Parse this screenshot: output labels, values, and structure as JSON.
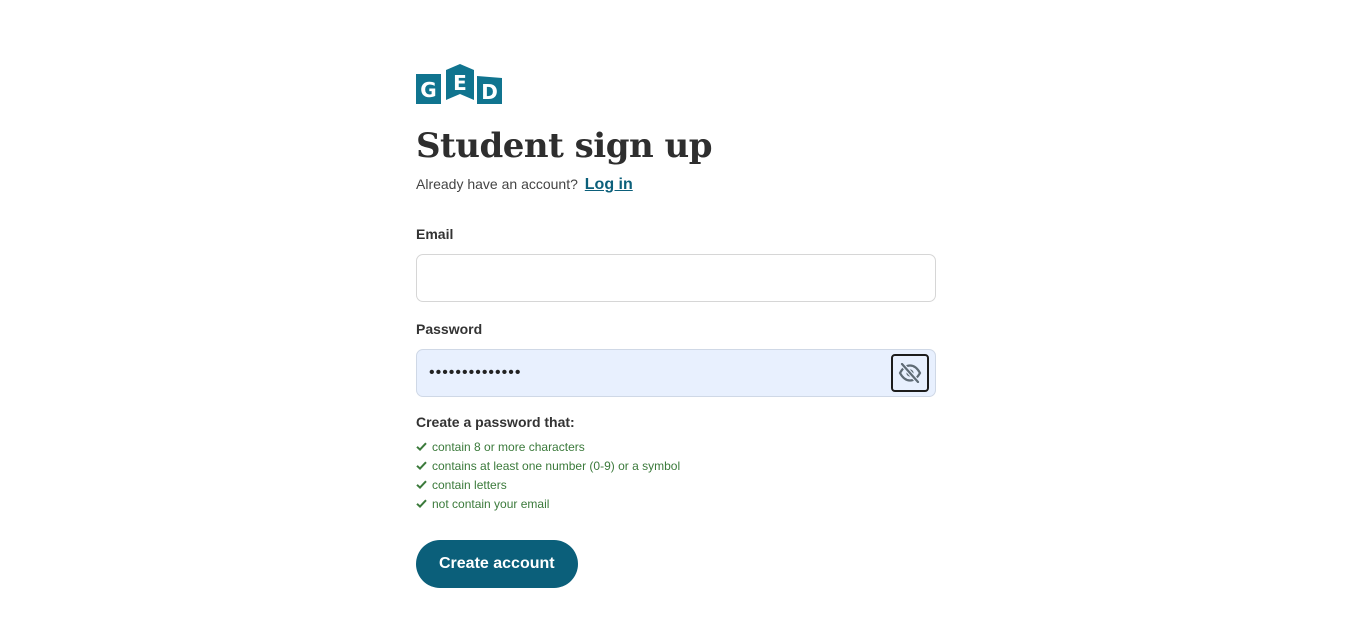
{
  "logo": {
    "letters": [
      "G",
      "E",
      "D"
    ],
    "color": "#10748f"
  },
  "header": {
    "title": "Student sign up",
    "subtitle": "Already have an account?",
    "login_link": "Log in"
  },
  "form": {
    "email": {
      "label": "Email",
      "value": ""
    },
    "password": {
      "label": "Password",
      "value": "••••••••••••••",
      "toggle_icon": "eye-slash-icon"
    },
    "requirements": {
      "title": "Create a password that:",
      "items": [
        "contain 8 or more characters",
        "contains at least one number (0-9) or a symbol",
        "contain letters",
        "not contain your email"
      ],
      "status_color": "#3b7a3b"
    },
    "submit_label": "Create account"
  },
  "colors": {
    "primary": "#0b5f7a",
    "password_fill": "#e8f0fe"
  }
}
